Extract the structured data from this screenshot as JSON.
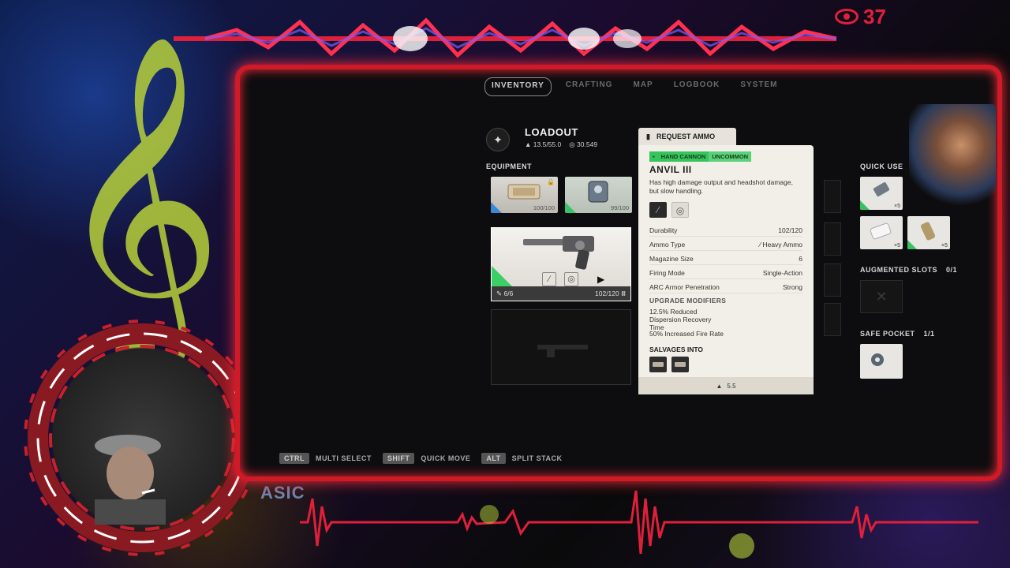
{
  "overlay": {
    "viewer_count": "37",
    "brand_text": "ASIC"
  },
  "tabs": [
    {
      "label": "INVENTORY",
      "active": true
    },
    {
      "label": "CRAFTING",
      "active": false
    },
    {
      "label": "MAP",
      "active": false
    },
    {
      "label": "LOGBOOK",
      "active": false
    },
    {
      "label": "SYSTEM",
      "active": false
    }
  ],
  "loadout": {
    "title": "LOADOUT",
    "weight": "13.5/55.0",
    "value": "30.549"
  },
  "equipment": {
    "label": "EQUIPMENT",
    "slots": [
      {
        "name": "shield",
        "condition": "100/100",
        "locked": true
      },
      {
        "name": "augment",
        "condition": "99/100",
        "locked": false
      }
    ],
    "weapon": {
      "ammo": "6/6",
      "durability": "102/120"
    }
  },
  "tooltip": {
    "request_ammo": "REQUEST AMMO",
    "tags": [
      "HAND CANNON",
      "UNCOMMON"
    ],
    "name": "ANVIL III",
    "description": "Has high damage output and headshot damage, but slow handling.",
    "stats": [
      {
        "label": "Durability",
        "value": "102/120"
      },
      {
        "label": "Ammo Type",
        "value": "Heavy Ammo"
      },
      {
        "label": "Magazine Size",
        "value": "6"
      },
      {
        "label": "Firing Mode",
        "value": "Single-Action"
      },
      {
        "label": "ARC Armor Penetration",
        "value": "Strong"
      }
    ],
    "upgrade_title": "UPGRADE MODIFIERS",
    "upgrades": [
      "12.5% Reduced Dispersion Recovery Time",
      "50% Increased Fire Rate"
    ],
    "salvage_title": "SALVAGES INTO",
    "weight": "5.5"
  },
  "right_panel": {
    "quick_use": "QUICK USE",
    "quick_slots": [
      {
        "count": "×5"
      },
      {
        "count": "×5"
      },
      {
        "count": "×5"
      }
    ],
    "augmented_label": "AUGMENTED SLOTS",
    "augmented_count": "0/1",
    "safe_pocket_label": "SAFE POCKET",
    "safe_pocket_count": "1/1"
  },
  "hints": [
    {
      "key": "CTRL",
      "label": "MULTI SELECT"
    },
    {
      "key": "SHIFT",
      "label": "QUICK MOVE"
    },
    {
      "key": "ALT",
      "label": "SPLIT STACK"
    }
  ],
  "colors": {
    "frame_red": "#d01a26",
    "rarity_green": "#36c45c",
    "panel_bg": "#0d0d0f",
    "card_bg": "#f2efe8"
  }
}
